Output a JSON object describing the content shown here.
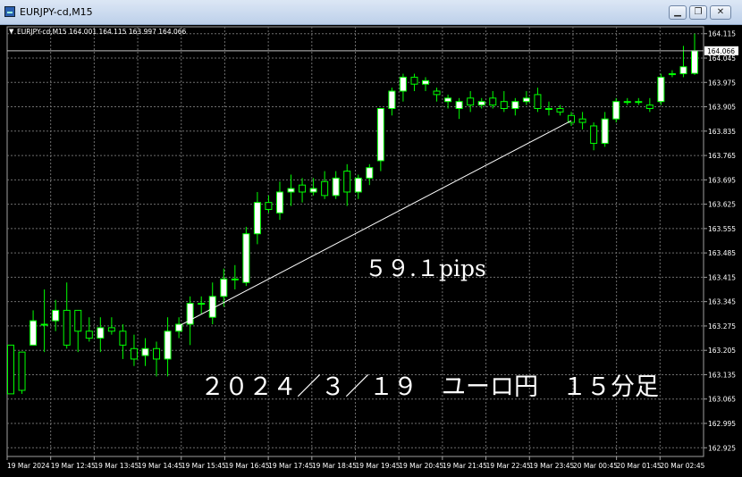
{
  "window": {
    "title": "EURJPY-cd,M15",
    "minimize_icon": "minimize-icon",
    "restore_icon": "restore-icon",
    "close_icon": "close-icon"
  },
  "chart_info": "EURJPY-cd,M15  164.001 164.115 163.997 164.066",
  "annotations": {
    "pips": "５９.１pips",
    "caption": "２０２４／３／１９　ユーロ円　１５分足"
  },
  "colors": {
    "background": "#000000",
    "grid": "#6e6e6e",
    "bull_fill": "#ffffff",
    "bull_wick": "#00ff00",
    "bear_fill": "#000000",
    "bear_outline": "#00ff00",
    "current_price_line": "#c0c0c0",
    "trend_line": "#ffffff",
    "text": "#ffffff"
  },
  "chart_data": {
    "type": "candlestick",
    "symbol": "EURJPY-cd",
    "timeframe": "M15",
    "ohlc_last": {
      "open": 164.001,
      "high": 164.115,
      "low": 163.997,
      "close": 164.066
    },
    "current_price": 164.066,
    "ylim": [
      162.9,
      164.14
    ],
    "y_ticks": [
      164.115,
      164.045,
      163.975,
      163.905,
      163.835,
      163.765,
      163.695,
      163.625,
      163.555,
      163.485,
      163.415,
      163.345,
      163.275,
      163.205,
      163.135,
      163.065,
      162.995,
      162.925
    ],
    "x_ticks": [
      "19 Mar 2024",
      "19 Mar 12:45",
      "19 Mar 13:45",
      "19 Mar 14:45",
      "19 Mar 15:45",
      "19 Mar 16:45",
      "19 Mar 17:45",
      "19 Mar 18:45",
      "19 Mar 19:45",
      "19 Mar 20:45",
      "19 Mar 21:45",
      "19 Mar 22:45",
      "19 Mar 23:45",
      "20 Mar 00:45",
      "20 Mar 01:45",
      "20 Mar 02:45"
    ],
    "trend_line": {
      "from": {
        "bar": 15,
        "price": 163.275
      },
      "to": {
        "bar": 50,
        "price": 163.865
      },
      "label": "５９.１pips"
    },
    "candles": [
      [
        163.22,
        163.08,
        163.22,
        163.08
      ],
      [
        163.2,
        163.2,
        163.08,
        163.09
      ],
      [
        163.22,
        163.32,
        163.22,
        163.29
      ],
      [
        163.28,
        163.38,
        163.2,
        163.28
      ],
      [
        163.29,
        163.35,
        163.26,
        163.32
      ],
      [
        163.32,
        163.4,
        163.21,
        163.22
      ],
      [
        163.32,
        163.32,
        163.2,
        163.26
      ],
      [
        163.26,
        163.3,
        163.23,
        163.24
      ],
      [
        163.24,
        163.3,
        163.2,
        163.27
      ],
      [
        163.27,
        163.3,
        163.25,
        163.26
      ],
      [
        163.26,
        163.28,
        163.18,
        163.22
      ],
      [
        163.21,
        163.25,
        163.16,
        163.18
      ],
      [
        163.19,
        163.24,
        163.16,
        163.21
      ],
      [
        163.21,
        163.23,
        163.13,
        163.18
      ],
      [
        163.18,
        163.3,
        163.13,
        163.26
      ],
      [
        163.26,
        163.3,
        163.24,
        163.28
      ],
      [
        163.28,
        163.36,
        163.22,
        163.34
      ],
      [
        163.34,
        163.36,
        163.31,
        163.34
      ],
      [
        163.3,
        163.4,
        163.28,
        163.36
      ],
      [
        163.36,
        163.44,
        163.33,
        163.41
      ],
      [
        163.41,
        163.45,
        163.38,
        163.41
      ],
      [
        163.4,
        163.56,
        163.39,
        163.54
      ],
      [
        163.54,
        163.66,
        163.51,
        163.63
      ],
      [
        163.63,
        163.65,
        163.6,
        163.61
      ],
      [
        163.6,
        163.69,
        163.58,
        163.66
      ],
      [
        163.66,
        163.71,
        163.62,
        163.67
      ],
      [
        163.68,
        163.7,
        163.63,
        163.66
      ],
      [
        163.66,
        163.7,
        163.65,
        163.67
      ],
      [
        163.69,
        163.72,
        163.64,
        163.65
      ],
      [
        163.65,
        163.72,
        163.64,
        163.7
      ],
      [
        163.72,
        163.74,
        163.62,
        163.66
      ],
      [
        163.66,
        163.71,
        163.64,
        163.7
      ],
      [
        163.7,
        163.74,
        163.68,
        163.73
      ],
      [
        163.75,
        163.9,
        163.72,
        163.9
      ],
      [
        163.9,
        163.96,
        163.88,
        163.95
      ],
      [
        163.95,
        164.0,
        163.92,
        163.99
      ],
      [
        163.99,
        164.0,
        163.95,
        163.97
      ],
      [
        163.97,
        163.99,
        163.95,
        163.98
      ],
      [
        163.95,
        163.96,
        163.92,
        163.94
      ],
      [
        163.92,
        163.94,
        163.9,
        163.93
      ],
      [
        163.9,
        163.93,
        163.87,
        163.92
      ],
      [
        163.93,
        163.95,
        163.89,
        163.91
      ],
      [
        163.91,
        163.93,
        163.9,
        163.92
      ],
      [
        163.93,
        163.95,
        163.9,
        163.91
      ],
      [
        163.92,
        163.95,
        163.89,
        163.9
      ],
      [
        163.9,
        163.93,
        163.88,
        163.92
      ],
      [
        163.92,
        163.95,
        163.91,
        163.93
      ],
      [
        163.94,
        163.96,
        163.89,
        163.9
      ],
      [
        163.9,
        163.92,
        163.88,
        163.9
      ],
      [
        163.9,
        163.91,
        163.88,
        163.89
      ],
      [
        163.88,
        163.89,
        163.85,
        163.86
      ],
      [
        163.87,
        163.89,
        163.84,
        163.86
      ],
      [
        163.85,
        163.86,
        163.78,
        163.8
      ],
      [
        163.8,
        163.89,
        163.79,
        163.87
      ],
      [
        163.87,
        163.93,
        163.86,
        163.92
      ],
      [
        163.92,
        163.93,
        163.91,
        163.92
      ],
      [
        163.92,
        163.93,
        163.91,
        163.92
      ],
      [
        163.91,
        163.93,
        163.89,
        163.9
      ],
      [
        163.92,
        164.0,
        163.91,
        163.99
      ],
      [
        164.0,
        164.01,
        163.99,
        164.0
      ],
      [
        164.0,
        164.08,
        163.99,
        164.02
      ],
      [
        164.001,
        164.115,
        163.997,
        164.066
      ]
    ]
  }
}
